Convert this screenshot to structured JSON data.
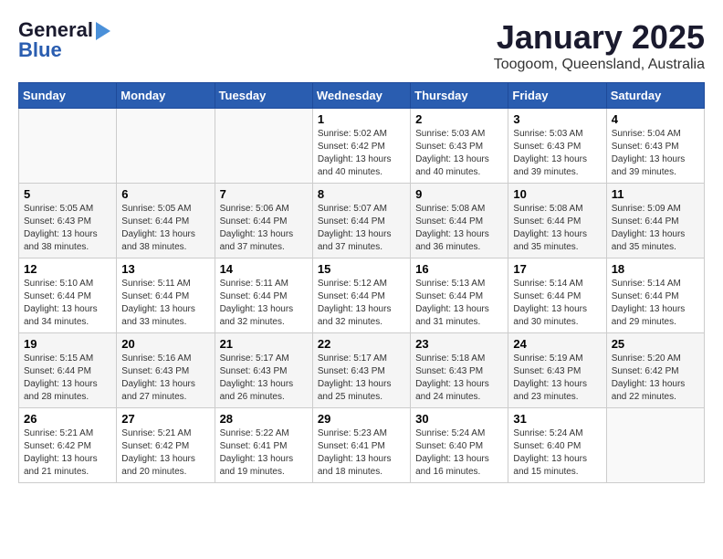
{
  "logo": {
    "line1": "General",
    "line2": "Blue"
  },
  "title": "January 2025",
  "subtitle": "Toogoom, Queensland, Australia",
  "headers": [
    "Sunday",
    "Monday",
    "Tuesday",
    "Wednesday",
    "Thursday",
    "Friday",
    "Saturday"
  ],
  "weeks": [
    [
      {
        "day": "",
        "info": ""
      },
      {
        "day": "",
        "info": ""
      },
      {
        "day": "",
        "info": ""
      },
      {
        "day": "1",
        "info": "Sunrise: 5:02 AM\nSunset: 6:42 PM\nDaylight: 13 hours\nand 40 minutes."
      },
      {
        "day": "2",
        "info": "Sunrise: 5:03 AM\nSunset: 6:43 PM\nDaylight: 13 hours\nand 40 minutes."
      },
      {
        "day": "3",
        "info": "Sunrise: 5:03 AM\nSunset: 6:43 PM\nDaylight: 13 hours\nand 39 minutes."
      },
      {
        "day": "4",
        "info": "Sunrise: 5:04 AM\nSunset: 6:43 PM\nDaylight: 13 hours\nand 39 minutes."
      }
    ],
    [
      {
        "day": "5",
        "info": "Sunrise: 5:05 AM\nSunset: 6:43 PM\nDaylight: 13 hours\nand 38 minutes."
      },
      {
        "day": "6",
        "info": "Sunrise: 5:05 AM\nSunset: 6:44 PM\nDaylight: 13 hours\nand 38 minutes."
      },
      {
        "day": "7",
        "info": "Sunrise: 5:06 AM\nSunset: 6:44 PM\nDaylight: 13 hours\nand 37 minutes."
      },
      {
        "day": "8",
        "info": "Sunrise: 5:07 AM\nSunset: 6:44 PM\nDaylight: 13 hours\nand 37 minutes."
      },
      {
        "day": "9",
        "info": "Sunrise: 5:08 AM\nSunset: 6:44 PM\nDaylight: 13 hours\nand 36 minutes."
      },
      {
        "day": "10",
        "info": "Sunrise: 5:08 AM\nSunset: 6:44 PM\nDaylight: 13 hours\nand 35 minutes."
      },
      {
        "day": "11",
        "info": "Sunrise: 5:09 AM\nSunset: 6:44 PM\nDaylight: 13 hours\nand 35 minutes."
      }
    ],
    [
      {
        "day": "12",
        "info": "Sunrise: 5:10 AM\nSunset: 6:44 PM\nDaylight: 13 hours\nand 34 minutes."
      },
      {
        "day": "13",
        "info": "Sunrise: 5:11 AM\nSunset: 6:44 PM\nDaylight: 13 hours\nand 33 minutes."
      },
      {
        "day": "14",
        "info": "Sunrise: 5:11 AM\nSunset: 6:44 PM\nDaylight: 13 hours\nand 32 minutes."
      },
      {
        "day": "15",
        "info": "Sunrise: 5:12 AM\nSunset: 6:44 PM\nDaylight: 13 hours\nand 32 minutes."
      },
      {
        "day": "16",
        "info": "Sunrise: 5:13 AM\nSunset: 6:44 PM\nDaylight: 13 hours\nand 31 minutes."
      },
      {
        "day": "17",
        "info": "Sunrise: 5:14 AM\nSunset: 6:44 PM\nDaylight: 13 hours\nand 30 minutes."
      },
      {
        "day": "18",
        "info": "Sunrise: 5:14 AM\nSunset: 6:44 PM\nDaylight: 13 hours\nand 29 minutes."
      }
    ],
    [
      {
        "day": "19",
        "info": "Sunrise: 5:15 AM\nSunset: 6:44 PM\nDaylight: 13 hours\nand 28 minutes."
      },
      {
        "day": "20",
        "info": "Sunrise: 5:16 AM\nSunset: 6:43 PM\nDaylight: 13 hours\nand 27 minutes."
      },
      {
        "day": "21",
        "info": "Sunrise: 5:17 AM\nSunset: 6:43 PM\nDaylight: 13 hours\nand 26 minutes."
      },
      {
        "day": "22",
        "info": "Sunrise: 5:17 AM\nSunset: 6:43 PM\nDaylight: 13 hours\nand 25 minutes."
      },
      {
        "day": "23",
        "info": "Sunrise: 5:18 AM\nSunset: 6:43 PM\nDaylight: 13 hours\nand 24 minutes."
      },
      {
        "day": "24",
        "info": "Sunrise: 5:19 AM\nSunset: 6:43 PM\nDaylight: 13 hours\nand 23 minutes."
      },
      {
        "day": "25",
        "info": "Sunrise: 5:20 AM\nSunset: 6:42 PM\nDaylight: 13 hours\nand 22 minutes."
      }
    ],
    [
      {
        "day": "26",
        "info": "Sunrise: 5:21 AM\nSunset: 6:42 PM\nDaylight: 13 hours\nand 21 minutes."
      },
      {
        "day": "27",
        "info": "Sunrise: 5:21 AM\nSunset: 6:42 PM\nDaylight: 13 hours\nand 20 minutes."
      },
      {
        "day": "28",
        "info": "Sunrise: 5:22 AM\nSunset: 6:41 PM\nDaylight: 13 hours\nand 19 minutes."
      },
      {
        "day": "29",
        "info": "Sunrise: 5:23 AM\nSunset: 6:41 PM\nDaylight: 13 hours\nand 18 minutes."
      },
      {
        "day": "30",
        "info": "Sunrise: 5:24 AM\nSunset: 6:40 PM\nDaylight: 13 hours\nand 16 minutes."
      },
      {
        "day": "31",
        "info": "Sunrise: 5:24 AM\nSunset: 6:40 PM\nDaylight: 13 hours\nand 15 minutes."
      },
      {
        "day": "",
        "info": ""
      }
    ]
  ]
}
